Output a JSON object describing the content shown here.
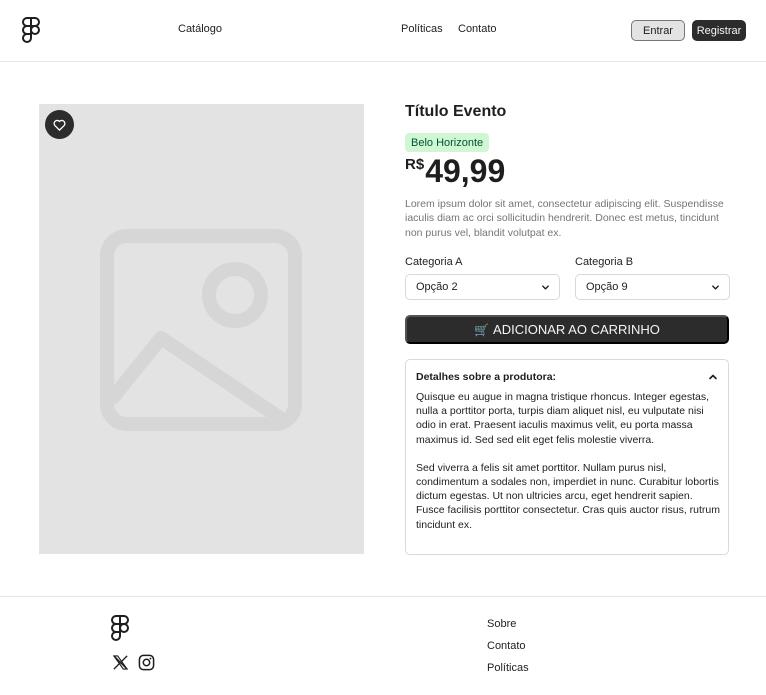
{
  "header": {
    "logo": "figma-logo-icon",
    "nav": {
      "catalogo": "Catálogo",
      "politicas": "Políticas",
      "contato": "Contato"
    },
    "login_label": "Entrar",
    "register_label": "Registrar"
  },
  "product": {
    "image": "image-placeholder-icon",
    "favorite_icon": "heart-icon",
    "title": "Título Evento",
    "location_tag": "Belo Horizonte",
    "price_currency": "R$",
    "price_value": "49,99",
    "description": "Lorem ipsum dolor sit amet, consectetur adipiscing elit. Suspendisse  iaculis diam ac orci sollicitudin hendrerit. Donec est metus, tincidunt  non purus vel, blandit volutpat ex.",
    "select_a": {
      "label": "Categoria A",
      "value": "Opção 2"
    },
    "select_b": {
      "label": "Categoria B",
      "value": "Opção 9"
    },
    "cart_button": {
      "icon": "🛒",
      "label": "ADICIONAR AO CARRINHO"
    },
    "details": {
      "title": "Detalhes sobre a produtora:",
      "paragraphs": [
        "Quisque eu augue in magna tristique rhoncus. Integer egestas, nulla a  porttitor porta, turpis diam aliquet nisl, eu vulputate nisi odio in  erat. Praesent iaculis maximus velit, eu porta massa maximus id. Sed sed elit eget felis molestie viverra.",
        "Sed viverra a felis sit amet  porttitor. Nullam purus nisl, condimentum a sodales non, imperdiet in  nunc. Curabitur lobortis dictum egestas. Ut non ultricies arcu, eget  hendrerit sapien. Fusce facilisis porttitor consectetur. Cras quis  auctor risus, rutrum tincidunt ex."
      ]
    }
  },
  "footer": {
    "logo": "figma-logo-icon",
    "social": [
      "x-twitter-icon",
      "instagram-icon"
    ],
    "links": {
      "sobre": "Sobre",
      "contato": "Contato",
      "politicas": "Políticas"
    }
  },
  "colors": {
    "dark": "#2c2c2c",
    "image_bg": "#e3e3e3",
    "tag_bg": "#cff7d3",
    "tag_text": "#02542d",
    "muted_text": "#757575",
    "border": "#d9d9d9"
  }
}
